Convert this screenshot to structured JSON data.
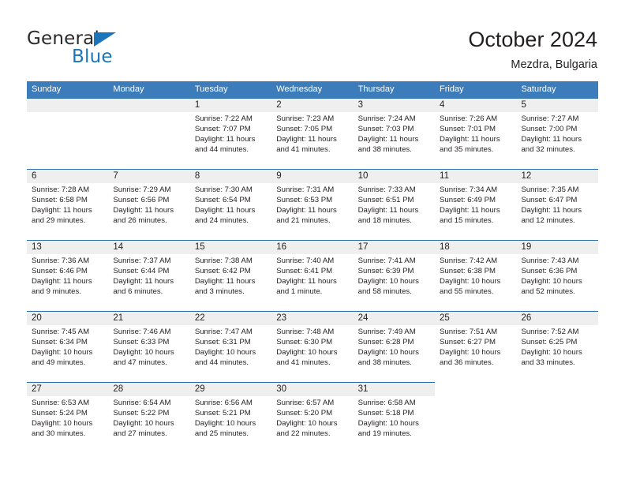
{
  "brand": {
    "name_top": "General",
    "name_bottom": "Blue",
    "accent_color": "#1b75bb"
  },
  "header": {
    "title": "October 2024",
    "subtitle": "Mezdra, Bulgaria"
  },
  "theme": {
    "header_row_bg": "#3d7cba",
    "day_number_bg": "#efefef",
    "cell_top_border": "#2b6cab",
    "text_color": "#231f20"
  },
  "calendar": {
    "weekday_headers": [
      "Sunday",
      "Monday",
      "Tuesday",
      "Wednesday",
      "Thursday",
      "Friday",
      "Saturday"
    ],
    "weeks": [
      [
        {
          "day": "",
          "empty": true
        },
        {
          "day": "",
          "empty": true
        },
        {
          "day": "1",
          "sunrise": "Sunrise: 7:22 AM",
          "sunset": "Sunset: 7:07 PM",
          "daylight": "Daylight: 11 hours and 44 minutes."
        },
        {
          "day": "2",
          "sunrise": "Sunrise: 7:23 AM",
          "sunset": "Sunset: 7:05 PM",
          "daylight": "Daylight: 11 hours and 41 minutes."
        },
        {
          "day": "3",
          "sunrise": "Sunrise: 7:24 AM",
          "sunset": "Sunset: 7:03 PM",
          "daylight": "Daylight: 11 hours and 38 minutes."
        },
        {
          "day": "4",
          "sunrise": "Sunrise: 7:26 AM",
          "sunset": "Sunset: 7:01 PM",
          "daylight": "Daylight: 11 hours and 35 minutes."
        },
        {
          "day": "5",
          "sunrise": "Sunrise: 7:27 AM",
          "sunset": "Sunset: 7:00 PM",
          "daylight": "Daylight: 11 hours and 32 minutes."
        }
      ],
      [
        {
          "day": "6",
          "sunrise": "Sunrise: 7:28 AM",
          "sunset": "Sunset: 6:58 PM",
          "daylight": "Daylight: 11 hours and 29 minutes."
        },
        {
          "day": "7",
          "sunrise": "Sunrise: 7:29 AM",
          "sunset": "Sunset: 6:56 PM",
          "daylight": "Daylight: 11 hours and 26 minutes."
        },
        {
          "day": "8",
          "sunrise": "Sunrise: 7:30 AM",
          "sunset": "Sunset: 6:54 PM",
          "daylight": "Daylight: 11 hours and 24 minutes."
        },
        {
          "day": "9",
          "sunrise": "Sunrise: 7:31 AM",
          "sunset": "Sunset: 6:53 PM",
          "daylight": "Daylight: 11 hours and 21 minutes."
        },
        {
          "day": "10",
          "sunrise": "Sunrise: 7:33 AM",
          "sunset": "Sunset: 6:51 PM",
          "daylight": "Daylight: 11 hours and 18 minutes."
        },
        {
          "day": "11",
          "sunrise": "Sunrise: 7:34 AM",
          "sunset": "Sunset: 6:49 PM",
          "daylight": "Daylight: 11 hours and 15 minutes."
        },
        {
          "day": "12",
          "sunrise": "Sunrise: 7:35 AM",
          "sunset": "Sunset: 6:47 PM",
          "daylight": "Daylight: 11 hours and 12 minutes."
        }
      ],
      [
        {
          "day": "13",
          "sunrise": "Sunrise: 7:36 AM",
          "sunset": "Sunset: 6:46 PM",
          "daylight": "Daylight: 11 hours and 9 minutes."
        },
        {
          "day": "14",
          "sunrise": "Sunrise: 7:37 AM",
          "sunset": "Sunset: 6:44 PM",
          "daylight": "Daylight: 11 hours and 6 minutes."
        },
        {
          "day": "15",
          "sunrise": "Sunrise: 7:38 AM",
          "sunset": "Sunset: 6:42 PM",
          "daylight": "Daylight: 11 hours and 3 minutes."
        },
        {
          "day": "16",
          "sunrise": "Sunrise: 7:40 AM",
          "sunset": "Sunset: 6:41 PM",
          "daylight": "Daylight: 11 hours and 1 minute."
        },
        {
          "day": "17",
          "sunrise": "Sunrise: 7:41 AM",
          "sunset": "Sunset: 6:39 PM",
          "daylight": "Daylight: 10 hours and 58 minutes."
        },
        {
          "day": "18",
          "sunrise": "Sunrise: 7:42 AM",
          "sunset": "Sunset: 6:38 PM",
          "daylight": "Daylight: 10 hours and 55 minutes."
        },
        {
          "day": "19",
          "sunrise": "Sunrise: 7:43 AM",
          "sunset": "Sunset: 6:36 PM",
          "daylight": "Daylight: 10 hours and 52 minutes."
        }
      ],
      [
        {
          "day": "20",
          "sunrise": "Sunrise: 7:45 AM",
          "sunset": "Sunset: 6:34 PM",
          "daylight": "Daylight: 10 hours and 49 minutes."
        },
        {
          "day": "21",
          "sunrise": "Sunrise: 7:46 AM",
          "sunset": "Sunset: 6:33 PM",
          "daylight": "Daylight: 10 hours and 47 minutes."
        },
        {
          "day": "22",
          "sunrise": "Sunrise: 7:47 AM",
          "sunset": "Sunset: 6:31 PM",
          "daylight": "Daylight: 10 hours and 44 minutes."
        },
        {
          "day": "23",
          "sunrise": "Sunrise: 7:48 AM",
          "sunset": "Sunset: 6:30 PM",
          "daylight": "Daylight: 10 hours and 41 minutes."
        },
        {
          "day": "24",
          "sunrise": "Sunrise: 7:49 AM",
          "sunset": "Sunset: 6:28 PM",
          "daylight": "Daylight: 10 hours and 38 minutes."
        },
        {
          "day": "25",
          "sunrise": "Sunrise: 7:51 AM",
          "sunset": "Sunset: 6:27 PM",
          "daylight": "Daylight: 10 hours and 36 minutes."
        },
        {
          "day": "26",
          "sunrise": "Sunrise: 7:52 AM",
          "sunset": "Sunset: 6:25 PM",
          "daylight": "Daylight: 10 hours and 33 minutes."
        }
      ],
      [
        {
          "day": "27",
          "sunrise": "Sunrise: 6:53 AM",
          "sunset": "Sunset: 5:24 PM",
          "daylight": "Daylight: 10 hours and 30 minutes."
        },
        {
          "day": "28",
          "sunrise": "Sunrise: 6:54 AM",
          "sunset": "Sunset: 5:22 PM",
          "daylight": "Daylight: 10 hours and 27 minutes."
        },
        {
          "day": "29",
          "sunrise": "Sunrise: 6:56 AM",
          "sunset": "Sunset: 5:21 PM",
          "daylight": "Daylight: 10 hours and 25 minutes."
        },
        {
          "day": "30",
          "sunrise": "Sunrise: 6:57 AM",
          "sunset": "Sunset: 5:20 PM",
          "daylight": "Daylight: 10 hours and 22 minutes."
        },
        {
          "day": "31",
          "sunrise": "Sunrise: 6:58 AM",
          "sunset": "Sunset: 5:18 PM",
          "daylight": "Daylight: 10 hours and 19 minutes."
        },
        {
          "day": "",
          "empty": true
        },
        {
          "day": "",
          "empty": true
        }
      ]
    ]
  }
}
